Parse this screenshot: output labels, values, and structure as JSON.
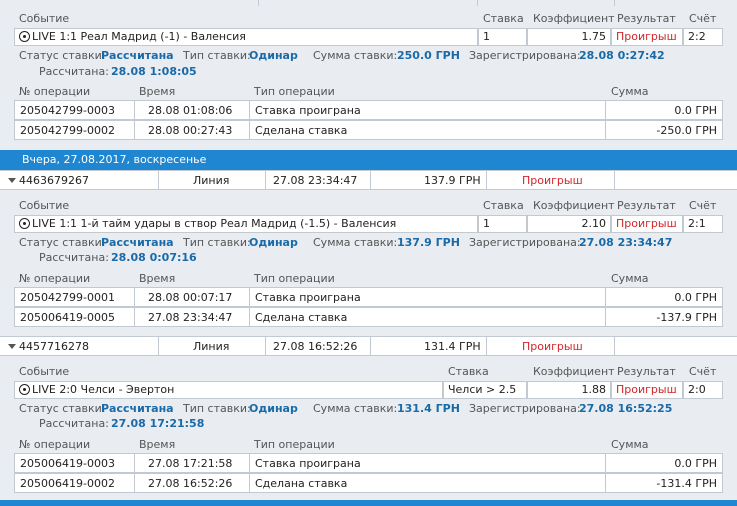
{
  "colors": {
    "accent": "#1f86d1",
    "lost": "#d0262a",
    "value": "#1a6aa8"
  },
  "headers": {
    "event": "Событие",
    "bet": "Ставка",
    "odds": "Коэффициент",
    "result": "Результат",
    "score": "Счёт",
    "op_num": "№ операции",
    "time": "Время",
    "op_type": "Тип операции",
    "sum": "Сумма"
  },
  "labels": {
    "status": "Статус ставки:",
    "type": "Тип ставки:",
    "amount": "Сумма ставки:",
    "registered": "Зарегистрирована:",
    "settled": "Рассчитана:"
  },
  "day_band": "Вчера, 27.08.2017, воскресенье",
  "block1": {
    "event": "LIVE 1:1 Реал Мадрид (-1) - Валенсия",
    "bet": "1",
    "odds": "1.75",
    "result": "Проигрыш",
    "score": "2:2",
    "status": "Рассчитана",
    "type": "Одинар",
    "amount": "250.0 ГРН",
    "registered": "28.08 0:27:42",
    "settled": "28.08 1:08:05",
    "ops": [
      {
        "num": "205042799-0003",
        "time": "28.08  01:08:06",
        "type": "Ставка проиграна",
        "sum": "0.0 ГРН"
      },
      {
        "num": "205042799-0002",
        "time": "28.08  00:27:43",
        "type": "Сделана ставка",
        "sum": "-250.0 ГРН"
      }
    ]
  },
  "block2": {
    "summary": {
      "id": "4463679267",
      "kind": "Линия",
      "datetime": "27.08  23:34:47",
      "amount": "137.9 ГРН",
      "result": "Проигрыш"
    },
    "event": "LIVE 1:1 1-й тайм удары в створ Реал Мадрид (-1.5) - Валенсия",
    "bet": "1",
    "odds": "2.10",
    "result": "Проигрыш",
    "score": "2:1",
    "status": "Рассчитана",
    "type": "Одинар",
    "amount": "137.9 ГРН",
    "registered": "27.08 23:34:47",
    "settled": "28.08 0:07:16",
    "ops": [
      {
        "num": "205042799-0001",
        "time": "28.08  00:07:17",
        "type": "Ставка проиграна",
        "sum": "0.0 ГРН"
      },
      {
        "num": "205006419-0005",
        "time": "27.08  23:34:47",
        "type": "Сделана ставка",
        "sum": "-137.9 ГРН"
      }
    ]
  },
  "block3": {
    "summary": {
      "id": "4457716278",
      "kind": "Линия",
      "datetime": "27.08  16:52:26",
      "amount": "131.4 ГРН",
      "result": "Проигрыш"
    },
    "event": "LIVE 2:0 Челси - Эвертон",
    "bet": "Челси > 2.5",
    "odds": "1.88",
    "result": "Проигрыш",
    "score": "2:0",
    "status": "Рассчитана",
    "type": "Одинар",
    "amount": "131.4 ГРН",
    "registered": "27.08 16:52:25",
    "settled": "27.08 17:21:58",
    "ops": [
      {
        "num": "205006419-0003",
        "time": "27.08  17:21:58",
        "type": "Ставка проиграна",
        "sum": "0.0 ГРН"
      },
      {
        "num": "205006419-0002",
        "time": "27.08  16:52:26",
        "type": "Сделана ставка",
        "sum": "-131.4 ГРН"
      }
    ]
  }
}
